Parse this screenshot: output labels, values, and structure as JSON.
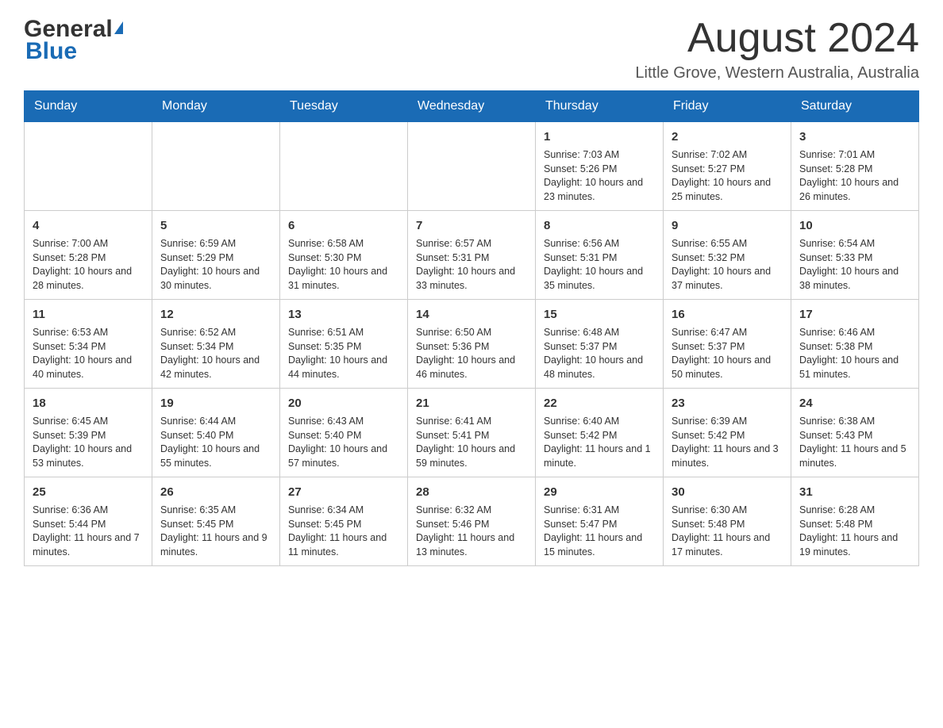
{
  "header": {
    "logo_general": "General",
    "logo_blue": "Blue",
    "month_title": "August 2024",
    "subtitle": "Little Grove, Western Australia, Australia"
  },
  "columns": [
    "Sunday",
    "Monday",
    "Tuesday",
    "Wednesday",
    "Thursday",
    "Friday",
    "Saturday"
  ],
  "weeks": [
    [
      {
        "day": "",
        "info": ""
      },
      {
        "day": "",
        "info": ""
      },
      {
        "day": "",
        "info": ""
      },
      {
        "day": "",
        "info": ""
      },
      {
        "day": "1",
        "info": "Sunrise: 7:03 AM\nSunset: 5:26 PM\nDaylight: 10 hours and 23 minutes."
      },
      {
        "day": "2",
        "info": "Sunrise: 7:02 AM\nSunset: 5:27 PM\nDaylight: 10 hours and 25 minutes."
      },
      {
        "day": "3",
        "info": "Sunrise: 7:01 AM\nSunset: 5:28 PM\nDaylight: 10 hours and 26 minutes."
      }
    ],
    [
      {
        "day": "4",
        "info": "Sunrise: 7:00 AM\nSunset: 5:28 PM\nDaylight: 10 hours and 28 minutes."
      },
      {
        "day": "5",
        "info": "Sunrise: 6:59 AM\nSunset: 5:29 PM\nDaylight: 10 hours and 30 minutes."
      },
      {
        "day": "6",
        "info": "Sunrise: 6:58 AM\nSunset: 5:30 PM\nDaylight: 10 hours and 31 minutes."
      },
      {
        "day": "7",
        "info": "Sunrise: 6:57 AM\nSunset: 5:31 PM\nDaylight: 10 hours and 33 minutes."
      },
      {
        "day": "8",
        "info": "Sunrise: 6:56 AM\nSunset: 5:31 PM\nDaylight: 10 hours and 35 minutes."
      },
      {
        "day": "9",
        "info": "Sunrise: 6:55 AM\nSunset: 5:32 PM\nDaylight: 10 hours and 37 minutes."
      },
      {
        "day": "10",
        "info": "Sunrise: 6:54 AM\nSunset: 5:33 PM\nDaylight: 10 hours and 38 minutes."
      }
    ],
    [
      {
        "day": "11",
        "info": "Sunrise: 6:53 AM\nSunset: 5:34 PM\nDaylight: 10 hours and 40 minutes."
      },
      {
        "day": "12",
        "info": "Sunrise: 6:52 AM\nSunset: 5:34 PM\nDaylight: 10 hours and 42 minutes."
      },
      {
        "day": "13",
        "info": "Sunrise: 6:51 AM\nSunset: 5:35 PM\nDaylight: 10 hours and 44 minutes."
      },
      {
        "day": "14",
        "info": "Sunrise: 6:50 AM\nSunset: 5:36 PM\nDaylight: 10 hours and 46 minutes."
      },
      {
        "day": "15",
        "info": "Sunrise: 6:48 AM\nSunset: 5:37 PM\nDaylight: 10 hours and 48 minutes."
      },
      {
        "day": "16",
        "info": "Sunrise: 6:47 AM\nSunset: 5:37 PM\nDaylight: 10 hours and 50 minutes."
      },
      {
        "day": "17",
        "info": "Sunrise: 6:46 AM\nSunset: 5:38 PM\nDaylight: 10 hours and 51 minutes."
      }
    ],
    [
      {
        "day": "18",
        "info": "Sunrise: 6:45 AM\nSunset: 5:39 PM\nDaylight: 10 hours and 53 minutes."
      },
      {
        "day": "19",
        "info": "Sunrise: 6:44 AM\nSunset: 5:40 PM\nDaylight: 10 hours and 55 minutes."
      },
      {
        "day": "20",
        "info": "Sunrise: 6:43 AM\nSunset: 5:40 PM\nDaylight: 10 hours and 57 minutes."
      },
      {
        "day": "21",
        "info": "Sunrise: 6:41 AM\nSunset: 5:41 PM\nDaylight: 10 hours and 59 minutes."
      },
      {
        "day": "22",
        "info": "Sunrise: 6:40 AM\nSunset: 5:42 PM\nDaylight: 11 hours and 1 minute."
      },
      {
        "day": "23",
        "info": "Sunrise: 6:39 AM\nSunset: 5:42 PM\nDaylight: 11 hours and 3 minutes."
      },
      {
        "day": "24",
        "info": "Sunrise: 6:38 AM\nSunset: 5:43 PM\nDaylight: 11 hours and 5 minutes."
      }
    ],
    [
      {
        "day": "25",
        "info": "Sunrise: 6:36 AM\nSunset: 5:44 PM\nDaylight: 11 hours and 7 minutes."
      },
      {
        "day": "26",
        "info": "Sunrise: 6:35 AM\nSunset: 5:45 PM\nDaylight: 11 hours and 9 minutes."
      },
      {
        "day": "27",
        "info": "Sunrise: 6:34 AM\nSunset: 5:45 PM\nDaylight: 11 hours and 11 minutes."
      },
      {
        "day": "28",
        "info": "Sunrise: 6:32 AM\nSunset: 5:46 PM\nDaylight: 11 hours and 13 minutes."
      },
      {
        "day": "29",
        "info": "Sunrise: 6:31 AM\nSunset: 5:47 PM\nDaylight: 11 hours and 15 minutes."
      },
      {
        "day": "30",
        "info": "Sunrise: 6:30 AM\nSunset: 5:48 PM\nDaylight: 11 hours and 17 minutes."
      },
      {
        "day": "31",
        "info": "Sunrise: 6:28 AM\nSunset: 5:48 PM\nDaylight: 11 hours and 19 minutes."
      }
    ]
  ]
}
